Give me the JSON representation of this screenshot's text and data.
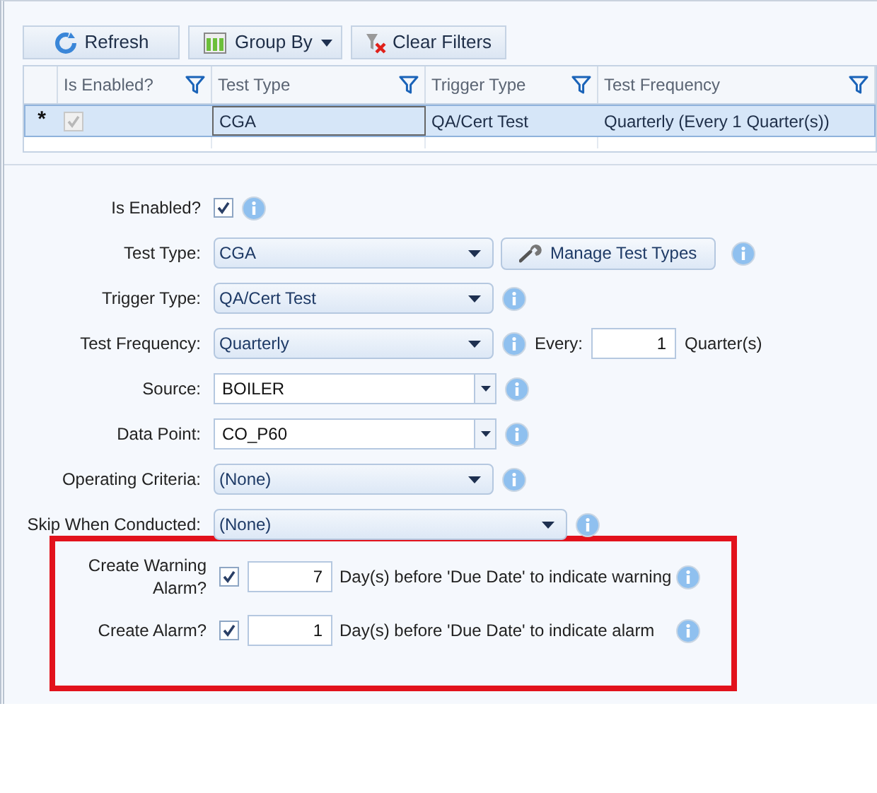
{
  "toolbar": {
    "refresh": "Refresh",
    "group_by": "Group By",
    "clear_filters": "Clear Filters"
  },
  "grid": {
    "columns": [
      {
        "label": "Is Enabled?"
      },
      {
        "label": "Test Type"
      },
      {
        "label": "Trigger Type"
      },
      {
        "label": "Test Frequency"
      }
    ],
    "rows": [
      {
        "marker": "*",
        "selected": true,
        "cells": [
          {
            "kind": "checkbox",
            "checked": true
          },
          {
            "kind": "text",
            "text": "CGA"
          },
          {
            "kind": "text",
            "text": "QA/Cert Test"
          },
          {
            "kind": "text",
            "text": "Quarterly (Every 1 Quarter(s))"
          }
        ]
      }
    ]
  },
  "form": [
    {
      "kind": "checkbox",
      "label": "Is Enabled?",
      "checked": true
    },
    {
      "kind": "combo",
      "label": "Test Type:",
      "value": "CGA",
      "button": "Manage Test Types"
    },
    {
      "kind": "combo",
      "label": "Trigger Type:",
      "value": "QA/Cert Test"
    },
    {
      "kind": "combo",
      "label": "Test Frequency:",
      "value": "Quarterly",
      "every_label": "Every:",
      "every_value": "1",
      "unit": "Quarter(s)"
    },
    {
      "kind": "editable",
      "label": "Source:",
      "value": "BOILER"
    },
    {
      "kind": "editable",
      "label": "Data Point:",
      "value": "CO_P60"
    },
    {
      "kind": "combo",
      "label": "Operating Criteria:",
      "value": "(None)"
    },
    {
      "kind": "widecombo",
      "label": "Skip When Conducted:",
      "value": "(None)"
    }
  ],
  "alarms": [
    {
      "label": "Create Warning Alarm?",
      "checked": true,
      "days": "7",
      "text": "Day(s) before 'Due Date' to indicate warning"
    },
    {
      "label": "Create Alarm?",
      "checked": true,
      "days": "1",
      "text": "Day(s) before 'Due Date' to indicate alarm"
    }
  ]
}
